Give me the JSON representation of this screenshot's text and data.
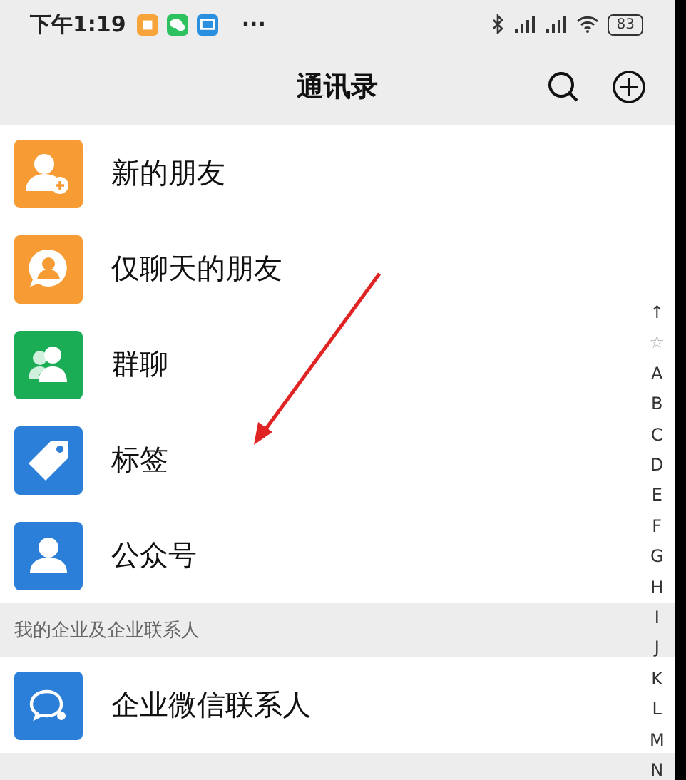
{
  "status_bar": {
    "time": "下午1:19",
    "more": "···",
    "battery": "83"
  },
  "header": {
    "title": "通讯录"
  },
  "top_items": [
    {
      "label": "新的朋友",
      "kind": "add-person",
      "color": "#f79c34"
    },
    {
      "label": "仅聊天的朋友",
      "kind": "chat-person",
      "color": "#f79c34"
    },
    {
      "label": "群聊",
      "kind": "group",
      "color": "#1aad56"
    },
    {
      "label": "标签",
      "kind": "tag",
      "color": "#2b7fd9"
    },
    {
      "label": "公众号",
      "kind": "person",
      "color": "#2b7fd9"
    }
  ],
  "section": {
    "title": "我的企业及企业联系人"
  },
  "work_items": [
    {
      "label": "企业微信联系人",
      "kind": "work-chat",
      "color": "#2b7fd9"
    }
  ],
  "index_bar": [
    "↑",
    "☆",
    "A",
    "B",
    "C",
    "D",
    "E",
    "F",
    "G",
    "H",
    "I",
    "J",
    "K",
    "L",
    "M",
    "N"
  ]
}
